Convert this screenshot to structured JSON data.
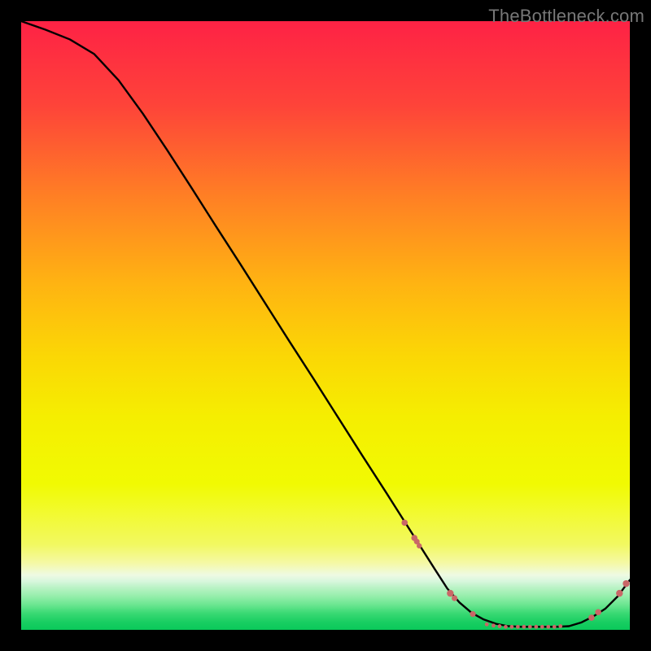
{
  "watermark": "TheBottleneck.com",
  "chart_data": {
    "type": "line",
    "title": "",
    "xlabel": "",
    "ylabel": "",
    "xlim": [
      0,
      100
    ],
    "ylim": [
      0,
      100
    ],
    "grid": false,
    "legend": false,
    "line": {
      "x": [
        0,
        4,
        8,
        12,
        16,
        20,
        24,
        28,
        32,
        36,
        40,
        44,
        48,
        52,
        56,
        60,
        64,
        68,
        70,
        72,
        74,
        76,
        78,
        80,
        82,
        84,
        86,
        88,
        90,
        92,
        94,
        96,
        98,
        100
      ],
      "y": [
        100,
        98.6,
        97,
        94.6,
        90.3,
        84.8,
        78.8,
        72.6,
        66.3,
        60.1,
        53.8,
        47.5,
        41.3,
        35.0,
        28.7,
        22.5,
        16.2,
        9.9,
        6.8,
        4.5,
        2.8,
        1.7,
        1.0,
        0.6,
        0.5,
        0.5,
        0.5,
        0.5,
        0.6,
        1.2,
        2.2,
        3.5,
        5.5,
        8.2
      ]
    },
    "markers": [
      {
        "x": 63.0,
        "y": 17.6,
        "r": 3.8
      },
      {
        "x": 64.6,
        "y": 15.1,
        "r": 3.8
      },
      {
        "x": 65.0,
        "y": 14.5,
        "r": 3.5
      },
      {
        "x": 65.4,
        "y": 13.8,
        "r": 3.2
      },
      {
        "x": 70.5,
        "y": 6.0,
        "r": 4.2
      },
      {
        "x": 71.2,
        "y": 5.2,
        "r": 3.6
      },
      {
        "x": 74.2,
        "y": 2.6,
        "r": 3.6
      },
      {
        "x": 76.5,
        "y": 0.9,
        "r": 2.4
      },
      {
        "x": 77.6,
        "y": 0.7,
        "r": 2.4
      },
      {
        "x": 78.6,
        "y": 0.6,
        "r": 2.4
      },
      {
        "x": 79.6,
        "y": 0.5,
        "r": 2.4
      },
      {
        "x": 80.6,
        "y": 0.5,
        "r": 2.4
      },
      {
        "x": 81.6,
        "y": 0.5,
        "r": 2.4
      },
      {
        "x": 82.6,
        "y": 0.5,
        "r": 2.4
      },
      {
        "x": 83.6,
        "y": 0.5,
        "r": 2.4
      },
      {
        "x": 84.6,
        "y": 0.5,
        "r": 2.4
      },
      {
        "x": 85.6,
        "y": 0.5,
        "r": 2.4
      },
      {
        "x": 86.6,
        "y": 0.5,
        "r": 2.4
      },
      {
        "x": 87.6,
        "y": 0.5,
        "r": 2.4
      },
      {
        "x": 88.6,
        "y": 0.6,
        "r": 2.4
      },
      {
        "x": 93.7,
        "y": 2.0,
        "r": 3.8
      },
      {
        "x": 94.8,
        "y": 2.9,
        "r": 3.8
      },
      {
        "x": 98.3,
        "y": 6.0,
        "r": 4.2
      },
      {
        "x": 99.4,
        "y": 7.6,
        "r": 4.2
      }
    ],
    "background_gradient": {
      "bands": [
        {
          "y": 100,
          "color": "#fe2245"
        },
        {
          "y": 86,
          "color": "#fe4439"
        },
        {
          "y": 71,
          "color": "#ff8024"
        },
        {
          "y": 57,
          "color": "#ffb312"
        },
        {
          "y": 45,
          "color": "#fbd705"
        },
        {
          "y": 35,
          "color": "#f5ee01"
        },
        {
          "y": 24,
          "color": "#f1fa02"
        },
        {
          "y": 14,
          "color": "#f2f961"
        },
        {
          "y": 11,
          "color": "#f5f9a5"
        },
        {
          "y": 9,
          "color": "#eefae3"
        },
        {
          "y": 8,
          "color": "#d8f7dd"
        },
        {
          "y": 7,
          "color": "#bbf3c6"
        },
        {
          "y": 5.5,
          "color": "#95eeab"
        },
        {
          "y": 4,
          "color": "#67e58e"
        },
        {
          "y": 2.7,
          "color": "#39d973"
        },
        {
          "y": 1.3,
          "color": "#19ce62"
        },
        {
          "y": 0,
          "color": "#0ac95a"
        }
      ]
    },
    "line_color": "#000000",
    "marker_color": "#c96767"
  }
}
